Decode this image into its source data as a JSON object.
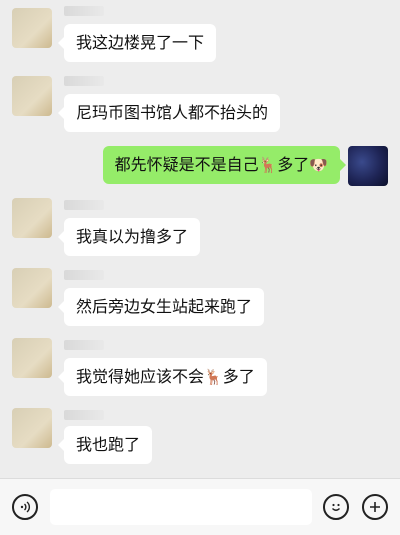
{
  "messages": [
    {
      "side": "left",
      "sender": "▪▪▪",
      "text": "我这边楼晃了一下"
    },
    {
      "side": "left",
      "sender": "▪▪▪",
      "text": "尼玛币图书馆人都不抬头的"
    },
    {
      "side": "right",
      "text": "都先怀疑是不是自己",
      "emoji1": "🦌",
      "text2": "多了",
      "emoji2": "🐶"
    },
    {
      "side": "left",
      "sender": "▪▪▪",
      "text": "我真以为撸多了"
    },
    {
      "side": "left",
      "sender": "▪▪▪",
      "text": "然后旁边女生站起来跑了"
    },
    {
      "side": "left",
      "sender": "▪▪▪",
      "text": "我觉得她应该不会",
      "emoji1": "🦌",
      "text2": "多了"
    },
    {
      "side": "left",
      "sender": "▪▪▪",
      "text": "我也跑了"
    }
  ],
  "footer": {
    "voice_icon": "voice-icon",
    "emoji_icon": "emoji-icon",
    "plus_icon": "plus-icon",
    "input_value": ""
  }
}
